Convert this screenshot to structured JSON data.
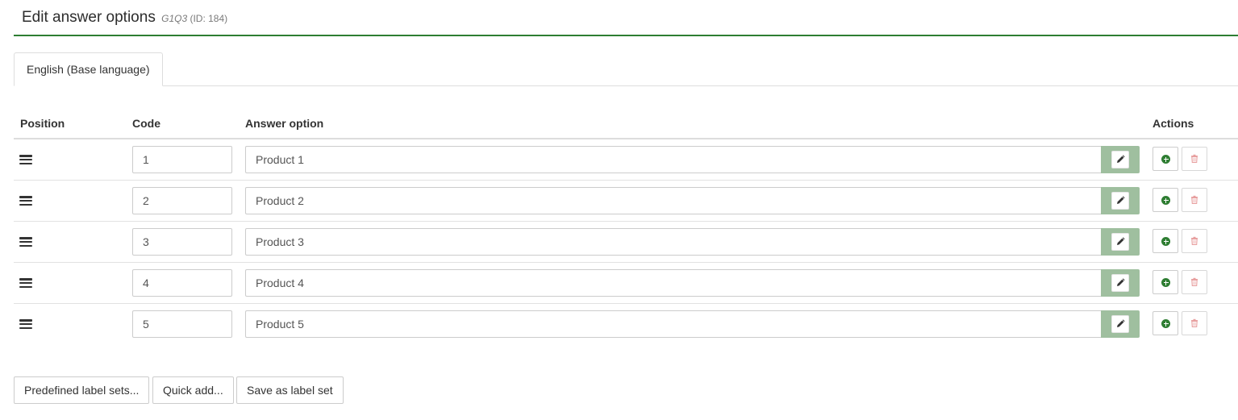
{
  "header": {
    "title": "Edit answer options",
    "question_code": "G1Q3",
    "question_id": "(ID: 184)"
  },
  "tabs": [
    {
      "label": "English (Base language)",
      "active": true
    }
  ],
  "table": {
    "columns": {
      "position": "Position",
      "code": "Code",
      "answer_option": "Answer option",
      "actions": "Actions"
    },
    "rows": [
      {
        "code": "1",
        "answer": "Product 1"
      },
      {
        "code": "2",
        "answer": "Product 2"
      },
      {
        "code": "3",
        "answer": "Product 3"
      },
      {
        "code": "4",
        "answer": "Product 4"
      },
      {
        "code": "5",
        "answer": "Product 5"
      }
    ]
  },
  "footer": {
    "predefined_label": "Predefined label sets...",
    "quick_add_label": "Quick add...",
    "save_label_set_label": "Save as label set"
  },
  "icons": {
    "drag": "bars-icon",
    "edit": "pencil-icon",
    "add": "plus-circle-icon",
    "delete": "trash-icon"
  },
  "colors": {
    "accent": "#2e7d32",
    "edit_button_bg": "#9fbf9f",
    "delete_icon": "#e8a1a1"
  }
}
